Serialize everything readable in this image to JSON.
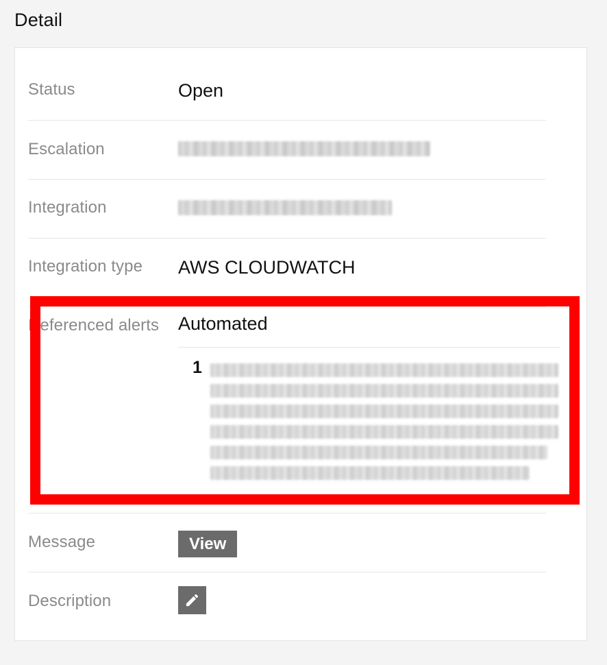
{
  "section": {
    "title": "Detail"
  },
  "rows": {
    "status": {
      "label": "Status",
      "value": "Open"
    },
    "escalation": {
      "label": "Escalation"
    },
    "integration": {
      "label": "Integration"
    },
    "integration_type": {
      "label": "Integration type",
      "value": "AWS CLOUDWATCH"
    },
    "referenced_alerts": {
      "label": "Referenced alerts",
      "value": "Automated",
      "items": [
        {
          "number": "1"
        }
      ]
    },
    "message": {
      "label": "Message",
      "button_label": "View"
    },
    "description": {
      "label": "Description",
      "edit_icon": "pencil-icon"
    }
  },
  "colors": {
    "highlight": "#ff0000",
    "button_bg": "#6b6b6b",
    "label": "#8a8a8a"
  }
}
